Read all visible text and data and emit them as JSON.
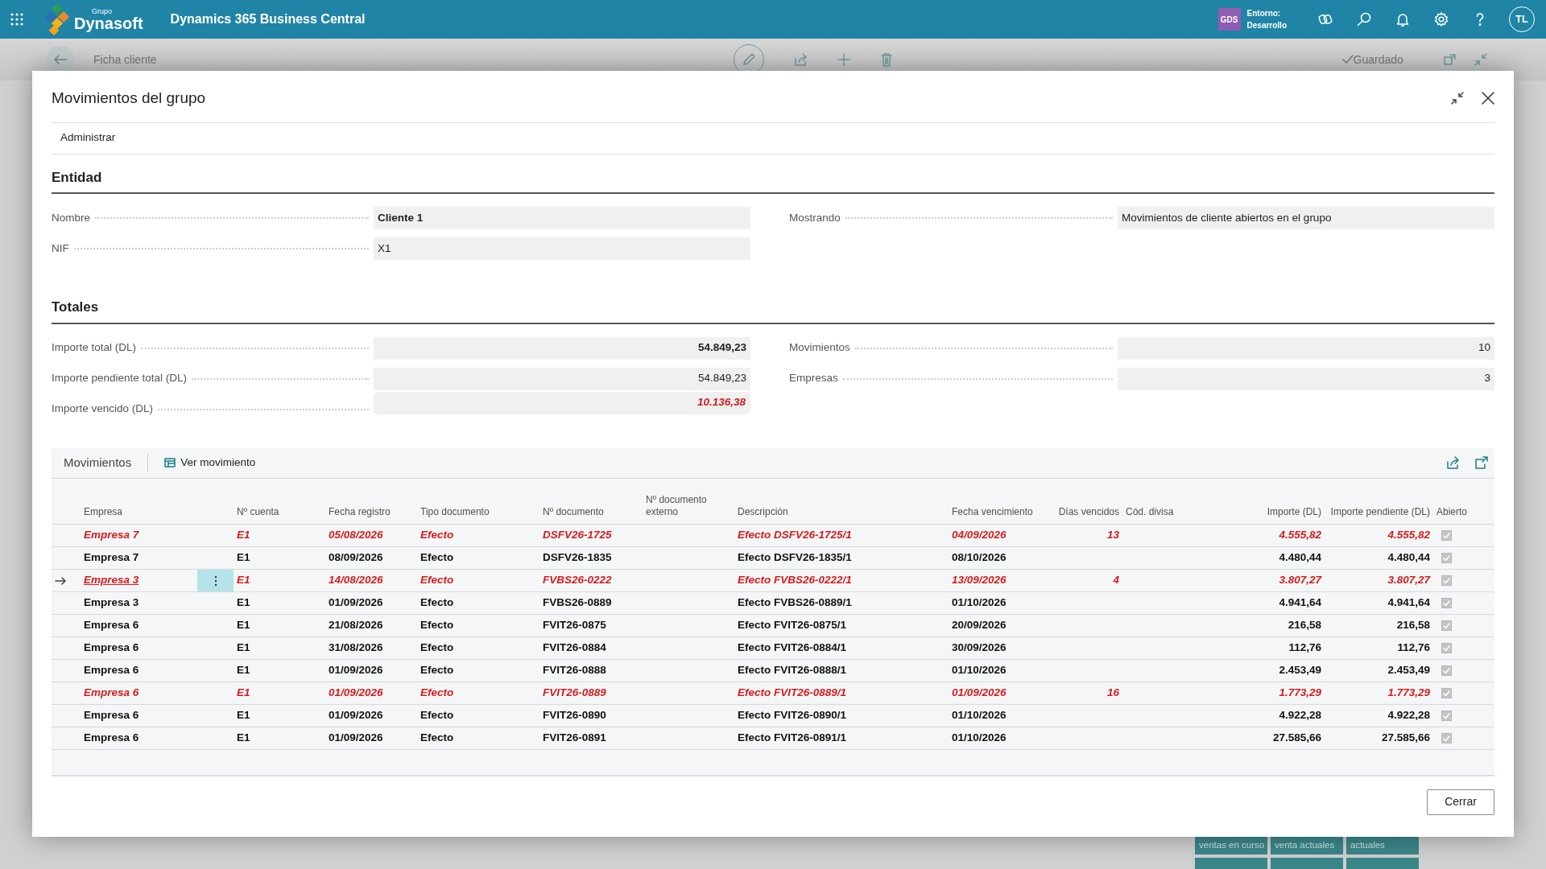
{
  "app": {
    "brand_small": "Grupo",
    "brand": "Dynasoft",
    "title": "Dynamics 365 Business Central",
    "env_badge": "GDS",
    "env_label": "Entorno:",
    "env_value": "Desarrollo",
    "avatar": "TL"
  },
  "background_page": {
    "title": "Ficha cliente",
    "status": "Guardado",
    "tiles": [
      "ventas en curso",
      "venta actuales",
      "actuales"
    ]
  },
  "dialog": {
    "title": "Movimientos del grupo",
    "actions": [
      "Administrar"
    ],
    "sections": [
      {
        "title": "Entidad",
        "left": [
          {
            "label": "Nombre",
            "value": "Cliente 1",
            "kind": "text-bold"
          },
          {
            "label": "NIF",
            "value": "X1",
            "kind": "text"
          }
        ],
        "right": [
          {
            "label": "Mostrando",
            "value": "Movimientos de cliente abiertos en el grupo",
            "kind": "text"
          }
        ]
      },
      {
        "title": "Totales",
        "left": [
          {
            "label": "Importe total (DL)",
            "value": "54.849,23",
            "kind": "amount-bold"
          },
          {
            "label": "Importe pendiente total (DL)",
            "value": "54.849,23",
            "kind": "amount"
          },
          {
            "label": "Importe vencido (DL)",
            "value": "10.136,38",
            "kind": "amount-alert"
          }
        ],
        "right": [
          {
            "label": "Movimientos",
            "value": "10",
            "kind": "amount"
          },
          {
            "label": "Empresas",
            "value": "3",
            "kind": "amount"
          }
        ]
      }
    ],
    "sub_list": {
      "title": "Movimientos",
      "action": "Ver movimiento",
      "columns": [
        "Empresa",
        "Nº cuenta",
        "Fecha registro",
        "Tipo documento",
        "Nº documento",
        "Nº documento externo",
        "Descripción",
        "Fecha vencimiento",
        "Días vencidos",
        "Cód. divisa",
        "Importe (DL)",
        "Importe pendiente (DL)",
        "Abierto"
      ],
      "rows": [
        {
          "empresa": "Empresa 7",
          "cuenta": "E1",
          "fecha_registro": "05/08/2026",
          "tipo": "Efecto",
          "documento": "DSFV26-1725",
          "descripcion": "Efecto DSFV26-1725/1",
          "vencimiento": "04/09/2026",
          "dias": "13",
          "importe": "4.555,82",
          "pendiente": "4.555,82",
          "abierto": true,
          "overdue": true,
          "selected": false
        },
        {
          "empresa": "Empresa 7",
          "cuenta": "E1",
          "fecha_registro": "08/09/2026",
          "tipo": "Efecto",
          "documento": "DSFV26-1835",
          "descripcion": "Efecto DSFV26-1835/1",
          "vencimiento": "08/10/2026",
          "importe": "4.480,44",
          "pendiente": "4.480,44",
          "abierto": true,
          "overdue": false,
          "selected": false
        },
        {
          "empresa": "Empresa 3",
          "cuenta": "E1",
          "fecha_registro": "14/08/2026",
          "tipo": "Efecto",
          "documento": "FVBS26-0222",
          "descripcion": "Efecto FVBS26-0222/1",
          "vencimiento": "13/09/2026",
          "dias": "4",
          "importe": "3.807,27",
          "pendiente": "3.807,27",
          "abierto": true,
          "overdue": true,
          "selected": true
        },
        {
          "empresa": "Empresa 3",
          "cuenta": "E1",
          "fecha_registro": "01/09/2026",
          "tipo": "Efecto",
          "documento": "FVBS26-0889",
          "descripcion": "Efecto FVBS26-0889/1",
          "vencimiento": "01/10/2026",
          "importe": "4.941,64",
          "pendiente": "4.941,64",
          "abierto": true,
          "overdue": false,
          "selected": false
        },
        {
          "empresa": "Empresa 6",
          "cuenta": "E1",
          "fecha_registro": "21/08/2026",
          "tipo": "Efecto",
          "documento": "FVIT26-0875",
          "descripcion": "Efecto FVIT26-0875/1",
          "vencimiento": "20/09/2026",
          "importe": "216,58",
          "pendiente": "216,58",
          "abierto": true,
          "overdue": false,
          "selected": false
        },
        {
          "empresa": "Empresa 6",
          "cuenta": "E1",
          "fecha_registro": "31/08/2026",
          "tipo": "Efecto",
          "documento": "FVIT26-0884",
          "descripcion": "Efecto FVIT26-0884/1",
          "vencimiento": "30/09/2026",
          "importe": "112,76",
          "pendiente": "112,76",
          "abierto": true,
          "overdue": false,
          "selected": false
        },
        {
          "empresa": "Empresa 6",
          "cuenta": "E1",
          "fecha_registro": "01/09/2026",
          "tipo": "Efecto",
          "documento": "FVIT26-0888",
          "descripcion": "Efecto FVIT26-0888/1",
          "vencimiento": "01/10/2026",
          "importe": "2.453,49",
          "pendiente": "2.453,49",
          "abierto": true,
          "overdue": false,
          "selected": false
        },
        {
          "empresa": "Empresa 6",
          "cuenta": "E1",
          "fecha_registro": "01/09/2026",
          "tipo": "Efecto",
          "documento": "FVIT26-0889",
          "descripcion": "Efecto FVIT26-0889/1",
          "vencimiento": "01/09/2026",
          "dias": "16",
          "importe": "1.773,29",
          "pendiente": "1.773,29",
          "abierto": true,
          "overdue": true,
          "selected": false
        },
        {
          "empresa": "Empresa 6",
          "cuenta": "E1",
          "fecha_registro": "01/09/2026",
          "tipo": "Efecto",
          "documento": "FVIT26-0890",
          "descripcion": "Efecto FVIT26-0890/1",
          "vencimiento": "01/10/2026",
          "importe": "4.922,28",
          "pendiente": "4.922,28",
          "abierto": true,
          "overdue": false,
          "selected": false
        },
        {
          "empresa": "Empresa 6",
          "cuenta": "E1",
          "fecha_registro": "01/09/2026",
          "tipo": "Efecto",
          "documento": "FVIT26-0891",
          "descripcion": "Efecto FVIT26-0891/1",
          "vencimiento": "01/10/2026",
          "importe": "27.585,66",
          "pendiente": "27.585,66",
          "abierto": true,
          "overdue": false,
          "selected": false
        }
      ]
    },
    "close_button": "Cerrar"
  }
}
